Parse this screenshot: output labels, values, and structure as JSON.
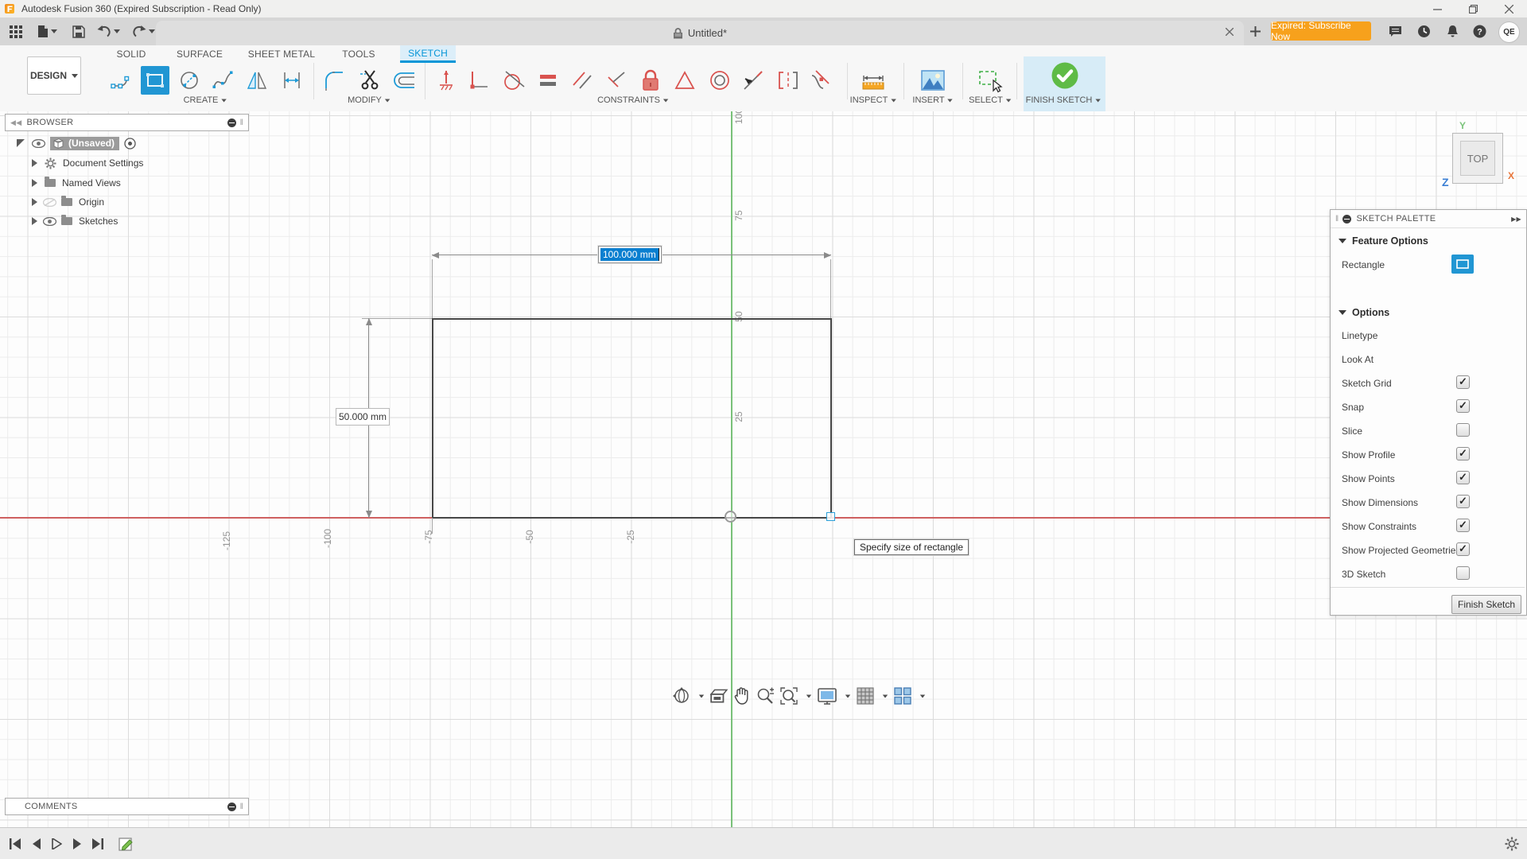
{
  "window": {
    "title": "Autodesk Fusion 360 (Expired Subscription - Read Only)"
  },
  "appbar": {
    "tab_title": "Untitled*",
    "subscribe_button": "Expired: Subscribe Now",
    "avatar_initials": "QE"
  },
  "ribbon": {
    "design_menu": "DESIGN",
    "tabs": [
      {
        "label": "SOLID",
        "active": false
      },
      {
        "label": "SURFACE",
        "active": false
      },
      {
        "label": "SHEET METAL",
        "active": false
      },
      {
        "label": "TOOLS",
        "active": false
      },
      {
        "label": "SKETCH",
        "active": true
      }
    ],
    "groups": [
      {
        "label": "CREATE"
      },
      {
        "label": "MODIFY"
      },
      {
        "label": "CONSTRAINTS"
      },
      {
        "label": "INSPECT"
      },
      {
        "label": "INSERT"
      },
      {
        "label": "SELECT"
      },
      {
        "label": "FINISH SKETCH"
      }
    ],
    "create_tools": [
      "line",
      "rectangle-2-point",
      "circle",
      "spline",
      "mirror",
      "dimension"
    ],
    "modify_tools": [
      "fillet",
      "trim",
      "offset"
    ],
    "constraint_tools": [
      "horizontal-vertical",
      "perpendicular-ground",
      "tangent",
      "equal",
      "parallel",
      "perpendicular",
      "fix-lock",
      "polygon",
      "concentric",
      "midpoint",
      "symmetry",
      "curvature"
    ],
    "active_tool": "rectangle-2-point"
  },
  "browser": {
    "header": "BROWSER",
    "items": [
      {
        "label": "(Unsaved)",
        "selected": true
      },
      {
        "label": "Document Settings"
      },
      {
        "label": "Named Views"
      },
      {
        "label": "Origin",
        "visibility": "hidden"
      },
      {
        "label": "Sketches",
        "visibility": "shown"
      }
    ]
  },
  "canvas": {
    "width_dimension": "100.000 mm",
    "height_dimension": "50.000 mm",
    "tooltip": "Specify size of rectangle",
    "viewcube_face": "TOP",
    "axis_x_label": "X",
    "axis_y_label": "Y",
    "axis_z_label": "Z",
    "ruler_y": [
      "100",
      "75",
      "50",
      "25"
    ],
    "ruler_x": [
      "-125",
      "-100",
      "-75",
      "-50",
      "-25"
    ]
  },
  "palette": {
    "header": "SKETCH PALETTE",
    "feature_section": "Feature Options",
    "feature_rows": [
      {
        "label": "Rectangle"
      }
    ],
    "options_section": "Options",
    "option_rows": [
      {
        "label": "Linetype",
        "control": "icons"
      },
      {
        "label": "Look At",
        "control": "icon"
      },
      {
        "label": "Sketch Grid",
        "control": "checkbox",
        "checked": true
      },
      {
        "label": "Snap",
        "control": "checkbox",
        "checked": true
      },
      {
        "label": "Slice",
        "control": "checkbox",
        "checked": false
      },
      {
        "label": "Show Profile",
        "control": "checkbox",
        "checked": true
      },
      {
        "label": "Show Points",
        "control": "checkbox",
        "checked": true
      },
      {
        "label": "Show Dimensions",
        "control": "checkbox",
        "checked": true
      },
      {
        "label": "Show Constraints",
        "control": "checkbox",
        "checked": true
      },
      {
        "label": "Show Projected Geometries",
        "control": "checkbox",
        "checked": true
      },
      {
        "label": "3D Sketch",
        "control": "checkbox",
        "checked": false
      }
    ],
    "finish_button": "Finish Sketch"
  },
  "comments": {
    "header": "COMMENTS"
  },
  "colors": {
    "accent_blue": "#0696d7",
    "selected_tool_blue": "#2196d3",
    "finish_green": "#5fbb46",
    "subscribe_orange": "#f7a11c",
    "axis_red": "#cf6060",
    "axis_green": "#79c179",
    "select_dash_green": "#3faf46"
  }
}
